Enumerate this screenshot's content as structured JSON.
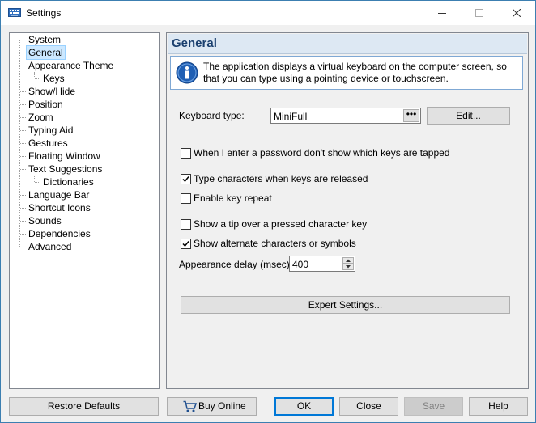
{
  "window": {
    "title": "Settings"
  },
  "tree": {
    "items": [
      {
        "label": "System",
        "level": 0
      },
      {
        "label": "General",
        "level": 0,
        "selected": true
      },
      {
        "label": "Appearance Theme",
        "level": 0
      },
      {
        "label": "Keys",
        "level": 1
      },
      {
        "label": "Show/Hide",
        "level": 0
      },
      {
        "label": "Position",
        "level": 0
      },
      {
        "label": "Zoom",
        "level": 0
      },
      {
        "label": "Typing Aid",
        "level": 0
      },
      {
        "label": "Gestures",
        "level": 0
      },
      {
        "label": "Floating Window",
        "level": 0
      },
      {
        "label": "Text Suggestions",
        "level": 0
      },
      {
        "label": "Dictionaries",
        "level": 1
      },
      {
        "label": "Language Bar",
        "level": 0
      },
      {
        "label": "Shortcut Icons",
        "level": 0
      },
      {
        "label": "Sounds",
        "level": 0
      },
      {
        "label": "Dependencies",
        "level": 0
      },
      {
        "label": "Advanced",
        "level": 0
      }
    ]
  },
  "panel": {
    "title": "General",
    "info_text": "The application displays a virtual keyboard on the computer screen, so that you can type using a pointing device or touchscreen."
  },
  "keyboard_type": {
    "label": "Keyboard type:",
    "value": "MiniFull",
    "browse_label": "•••",
    "edit_label": "Edit..."
  },
  "options": {
    "password": {
      "label": "When I enter a password don't show which keys are tapped",
      "checked": false
    },
    "type_on_release": {
      "label": "Type characters when keys are released",
      "checked": true
    },
    "key_repeat": {
      "label": "Enable key repeat",
      "checked": false
    },
    "show_tip": {
      "label": "Show a tip over a pressed character key",
      "checked": false
    },
    "show_alternate": {
      "label": "Show alternate characters or symbols",
      "checked": true
    }
  },
  "appearance_delay": {
    "label": "Appearance delay (msec):",
    "value": "400"
  },
  "expert_settings_label": "Expert Settings...",
  "footer": {
    "restore_defaults": "Restore Defaults",
    "buy_online": "Buy Online",
    "ok": "OK",
    "close": "Close",
    "save": "Save",
    "help": "Help"
  },
  "colors": {
    "accent": "#0078d7",
    "header_bg": "#dde8f3",
    "title_color": "#1a3f6e",
    "selection": "#cce8ff"
  }
}
